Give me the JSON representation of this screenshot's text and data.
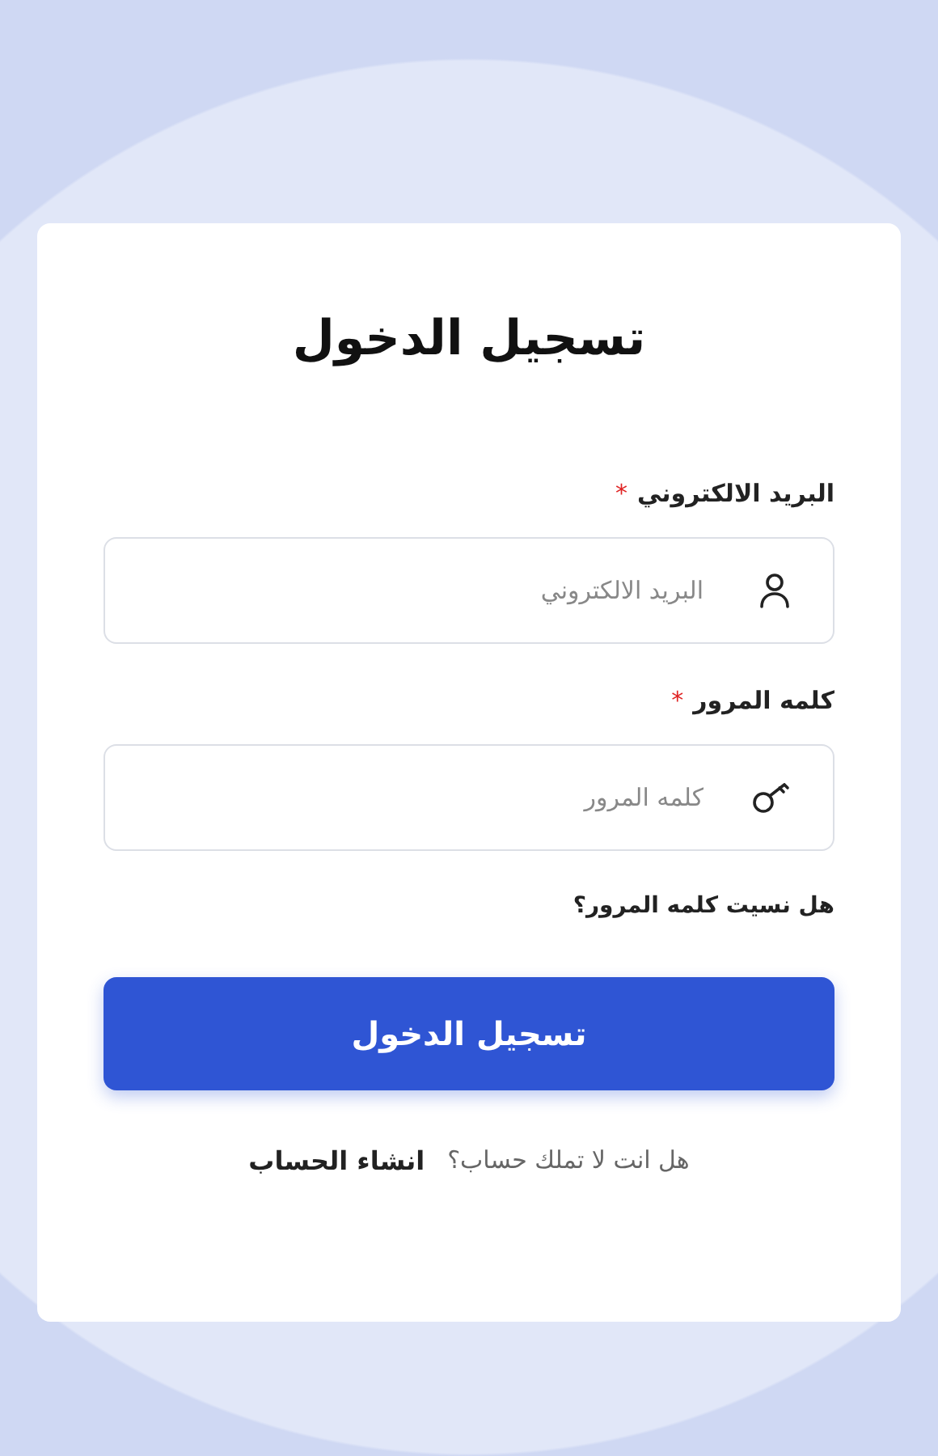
{
  "title": "تسجيل الدخول",
  "fields": [
    {
      "label": "البريد الالكتروني",
      "required_mark": "*",
      "placeholder": "البريد الالكتروني",
      "kind": "email"
    },
    {
      "label": "كلمه المرور",
      "required_mark": "*",
      "placeholder": "كلمه المرور",
      "kind": "password"
    }
  ],
  "forgot_link": "هل نسيت كلمه المرور؟",
  "submit_button": "تسجيل الدخول",
  "signup": {
    "prompt": "هل انت لا تملك حساب؟",
    "link": "انشاء الحساب"
  }
}
